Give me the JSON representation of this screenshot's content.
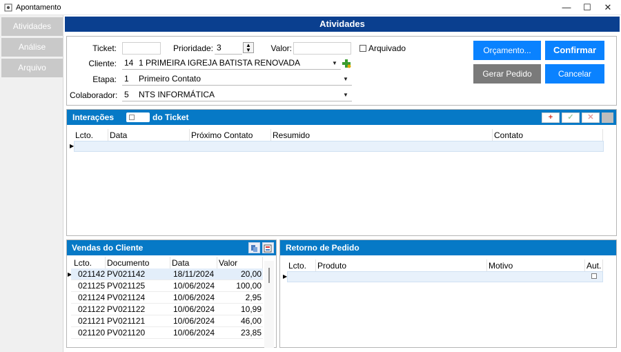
{
  "window": {
    "title": "Apontamento",
    "icon": "app-gear-icon",
    "controls": {
      "minimize": "—",
      "maximize": "☐",
      "close": "✕"
    }
  },
  "sidebar": {
    "items": [
      {
        "label": "Atividades"
      },
      {
        "label": "Análise"
      },
      {
        "label": "Arquivo"
      }
    ]
  },
  "header": {
    "title": "Atividades"
  },
  "form": {
    "ticket": {
      "label": "Ticket:",
      "value": ""
    },
    "prioridade": {
      "label": "Prioridade:",
      "value": "3"
    },
    "valor": {
      "label": "Valor:",
      "value": ""
    },
    "arquivado": {
      "label": "Arquivado",
      "checked": false
    },
    "cliente": {
      "label": "Cliente:",
      "code": "14",
      "name": "1 PRIMEIRA IGREJA BATISTA RENOVADA"
    },
    "etapa": {
      "label": "Etapa:",
      "code": "1",
      "name": "Primeiro Contato"
    },
    "colaborador": {
      "label": "Colaborador:",
      "code": "5",
      "name": "NTS INFORMÁTICA"
    }
  },
  "buttons": {
    "orcamento": "Orçamento...",
    "confirmar": "Confirmar",
    "gerar_pedido": "Gerar Pedido",
    "cancelar": "Cancelar"
  },
  "interacoes": {
    "title_left": "Interações",
    "title_right": "do Ticket",
    "action_add": "+",
    "action_ok": "✓",
    "action_cancel": "✕",
    "columns": [
      "Lcto.",
      "Data",
      "Próximo Contato",
      "Resumido",
      "Contato"
    ]
  },
  "vendas": {
    "title": "Vendas do Cliente",
    "columns": [
      "Lcto.",
      "Documento",
      "Data",
      "Valor"
    ],
    "rows": [
      {
        "lcto": "021142",
        "documento": "PV021142",
        "data": "18/11/2024",
        "valor": "20,00"
      },
      {
        "lcto": "021125",
        "documento": "PV021125",
        "data": "10/06/2024",
        "valor": "100,00"
      },
      {
        "lcto": "021124",
        "documento": "PV021124",
        "data": "10/06/2024",
        "valor": "2,95"
      },
      {
        "lcto": "021122",
        "documento": "PV021122",
        "data": "10/06/2024",
        "valor": "10,99"
      },
      {
        "lcto": "021121",
        "documento": "PV021121",
        "data": "10/06/2024",
        "valor": "46,00"
      },
      {
        "lcto": "021120",
        "documento": "PV021120",
        "data": "10/06/2024",
        "valor": "23,85"
      }
    ]
  },
  "retorno": {
    "title": "Retorno de Pedido",
    "columns": [
      "Lcto.",
      "Produto",
      "Motivo",
      "Aut."
    ]
  },
  "colors": {
    "header_blue": "#0a3f8f",
    "panel_blue": "#0679c6",
    "button_blue": "#0a82ff",
    "button_gray": "#7a7a7a",
    "sidebar_item": "#c9c9c9"
  }
}
